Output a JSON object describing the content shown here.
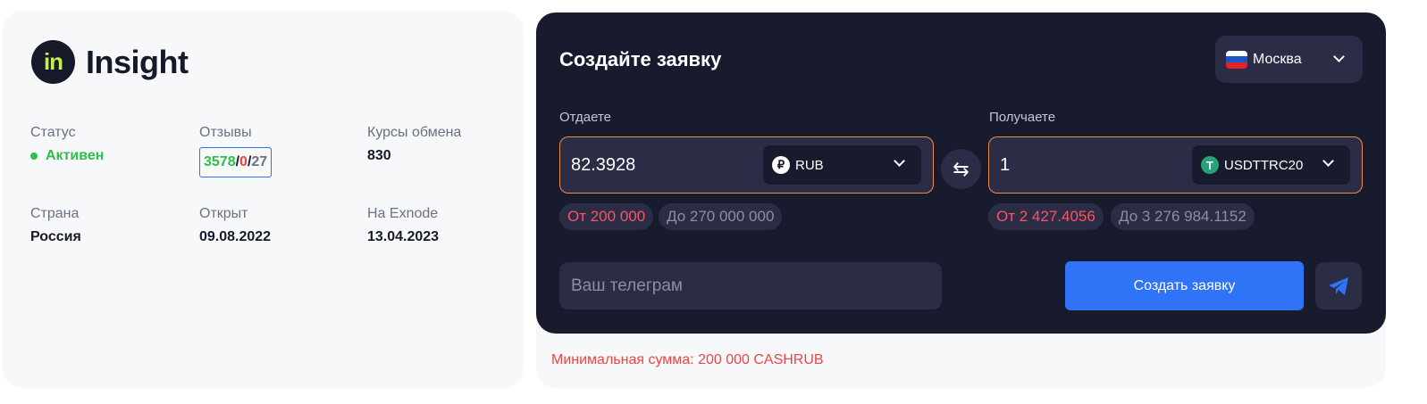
{
  "brand": {
    "logo_text": "in",
    "name": "Insight"
  },
  "info": {
    "status_label": "Статус",
    "status_value": "Активен",
    "reviews_label": "Отзывы",
    "reviews_positive": "3578",
    "reviews_negative": "0",
    "reviews_neutral": "27",
    "reviews_separator": "/",
    "rates_label": "Курсы обмена",
    "rates_value": "830",
    "country_label": "Страна",
    "country_value": "Россия",
    "opened_label": "Открыт",
    "opened_value": "09.08.2022",
    "exnode_label": "На Exnode",
    "exnode_value": "13.04.2023"
  },
  "form": {
    "title": "Создайте заявку",
    "city": "Москва",
    "give": {
      "label": "Отдаете",
      "amount": "82.3928",
      "currency": "RUB",
      "currency_icon": "ruble-icon",
      "min": "От 200 000",
      "max": "До 270 000 000"
    },
    "receive": {
      "label": "Получаете",
      "amount": "1",
      "currency": "USDTTRC20",
      "currency_icon": "tether-icon",
      "min": "От 2 427.4056",
      "max": "До 3 276 984.1152"
    },
    "telegram_placeholder": "Ваш телеграм",
    "submit_label": "Создать заявку",
    "min_note": "Минимальная сумма: 200 000 CASHRUB"
  },
  "colors": {
    "panel": "#181a2d",
    "accent": "#2f74f6",
    "success": "#2fbd4c",
    "danger": "#ef4444",
    "brand_logo_text": "#c8f03c",
    "input_border": "#f08a4b"
  }
}
